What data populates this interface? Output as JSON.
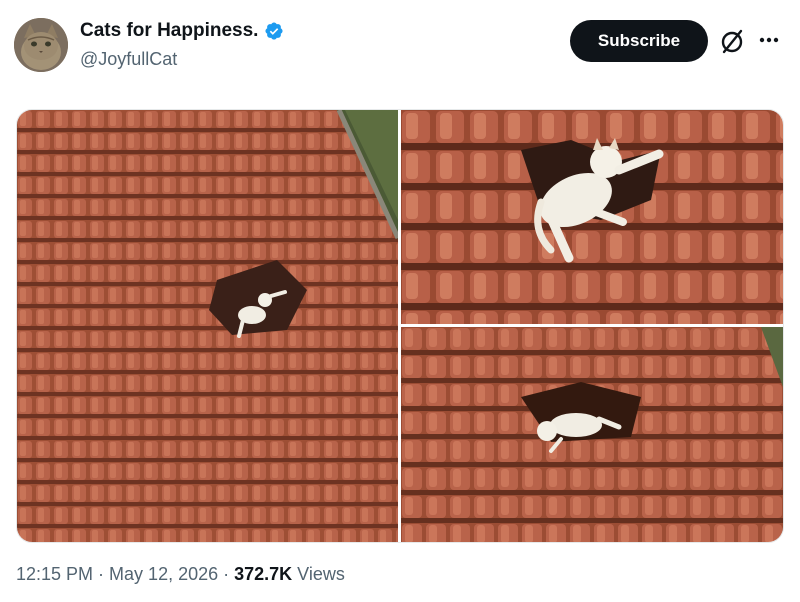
{
  "post": {
    "author": {
      "display_name": "Cats for Happiness.",
      "handle": "@JoyfullCat",
      "verified": true,
      "verified_color": "#1d9bf0"
    },
    "subscribe_label": "Subscribe",
    "more_icon": "more-horizontal-icon",
    "grok_icon": "grok-icon",
    "time": "12:15 PM",
    "separator": "·",
    "date": "May 12, 2026",
    "views_count": "372.7K",
    "views_label": "Views"
  },
  "colors": {
    "text": "#0f1419",
    "secondary": "#536471",
    "button_bg": "#0f1419",
    "roof_tile": "#a9553a"
  }
}
